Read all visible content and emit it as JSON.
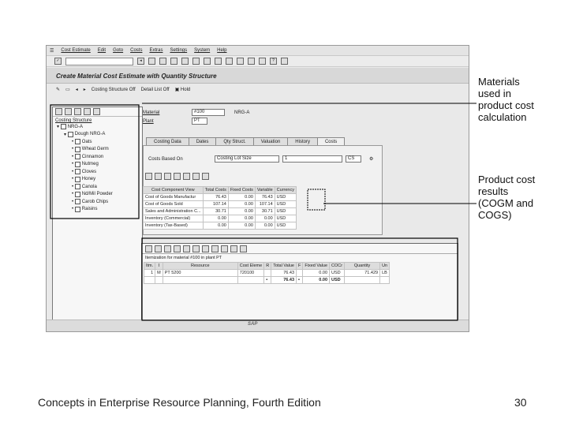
{
  "menu": [
    "Cost Estimate",
    "Edit",
    "Goto",
    "Costs",
    "Extras",
    "Settings",
    "System",
    "Help"
  ],
  "window_title": "Create Material Cost Estimate with Quantity Structure",
  "toolbar2": {
    "costing_structure": "Costing Structure Off",
    "detail_list": "Detail List Off",
    "hold": "Hold"
  },
  "nav": {
    "header": "Costing Structure",
    "root": "NRG-A",
    "parent": "Dough NRG-A",
    "items": [
      "Oats",
      "Wheat Germ",
      "Cinnamon",
      "Nutmeg",
      "Cloves",
      "Honey",
      "Canola",
      "Nd/Mil Powder",
      "Carob Chips",
      "Raisins"
    ]
  },
  "fields": {
    "material_label": "Material",
    "material_value": "#100",
    "material_desc": "NRG-A",
    "plant_label": "Plant",
    "plant_value": "PT"
  },
  "tabs": [
    "Costing Data",
    "Dates",
    "Qty Struct.",
    "Valuation",
    "History",
    "Costs"
  ],
  "costs_based_on": {
    "label": "Costs Based On",
    "value": "Costing Lot Size",
    "qty": "1",
    "unit": "CS"
  },
  "cost_table": {
    "headers": [
      "Cost Component View",
      "Total Costs",
      "Fixed Costs",
      "Variable",
      "Currency"
    ],
    "rows": [
      [
        "Cost of Goods Manufactur",
        "76.43",
        "0.00",
        "76.43",
        "USD"
      ],
      [
        "Cost of Goods Sold",
        "107.14",
        "0.00",
        "107.14",
        "USD"
      ],
      [
        "Sales and Administration C...",
        "30.71",
        "0.00",
        "30.71",
        "USD"
      ],
      [
        "Inventory (Commercial)",
        "0.00",
        "0.00",
        "0.00",
        "USD"
      ],
      [
        "Inventory (Tax-Based)",
        "0.00",
        "0.00",
        "0.00",
        "USD"
      ]
    ]
  },
  "itemization": {
    "caption": "Itemization for material #100 in plant PT",
    "headers": [
      "Itm.",
      "I",
      "Resource",
      "Cost Eleme",
      "R",
      "Total Value",
      "F",
      "Fixed Value",
      "COCr",
      "Quantity",
      "Un"
    ],
    "rows": [
      [
        "1",
        "M",
        "PT 5200",
        "720100",
        "",
        "76.43",
        "",
        "0.00",
        "USD",
        "71.429",
        "LB"
      ],
      [
        "",
        "",
        "",
        "",
        "•",
        "76.43",
        "•",
        "0.00",
        "USD",
        "",
        ""
      ]
    ]
  },
  "callouts": {
    "materials": [
      "Materials",
      "used in",
      "product cost",
      "calculation"
    ],
    "results": [
      "Product cost",
      "results",
      "(COGM and",
      "COGS)"
    ]
  },
  "footer": {
    "title": "Concepts in Enterprise Resource Planning, Fourth Edition",
    "page": "30"
  },
  "sap_logo": "SAP"
}
